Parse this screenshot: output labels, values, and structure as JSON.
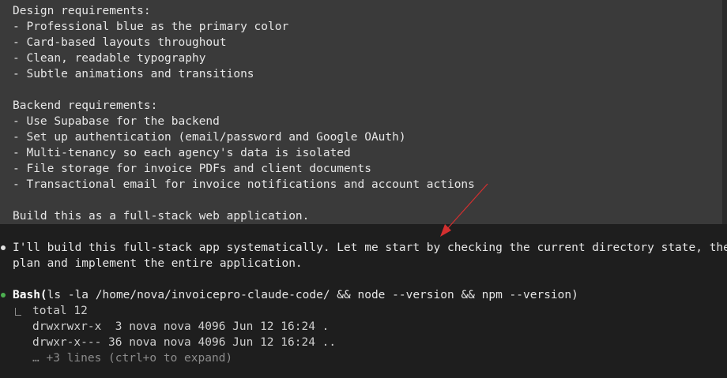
{
  "prompt": {
    "lines": [
      "Design requirements:",
      "- Professional blue as the primary color",
      "- Card-based layouts throughout",
      "- Clean, readable typography",
      "- Subtle animations and transitions",
      "",
      "Backend requirements:",
      "- Use Supabase for the backend",
      "- Set up authentication (email/password and Google OAuth)",
      "- Multi-tenancy so each agency's data is isolated",
      "- File storage for invoice PDFs and client documents",
      "- Transactional email for invoice notifications and account actions",
      "",
      "Build this as a full-stack web application."
    ]
  },
  "assistant": {
    "message_lines": [
      "I'll build this full-stack app systematically. Let me start by checking the current directory state, then",
      "plan and implement the entire application."
    ]
  },
  "tool_call": {
    "name": "Bash(",
    "args": "ls -la /home/nova/invoicepro-claude-code/ && node --version && npm --version)",
    "output_lines": [
      "total 12",
      "drwxrwxr-x  3 nova nova 4096 Jun 12 16:24 .",
      "drwxr-x--- 36 nova nova 4096 Jun 12 16:24 .."
    ],
    "collapsed_hint": "… +3 lines (ctrl+o to expand)"
  },
  "colors": {
    "prompt_background": "#3a3a3a",
    "terminal_background": "#1e1e1e",
    "tool_bullet": "#4caf50",
    "annotation_arrow": "#d32f2f"
  }
}
